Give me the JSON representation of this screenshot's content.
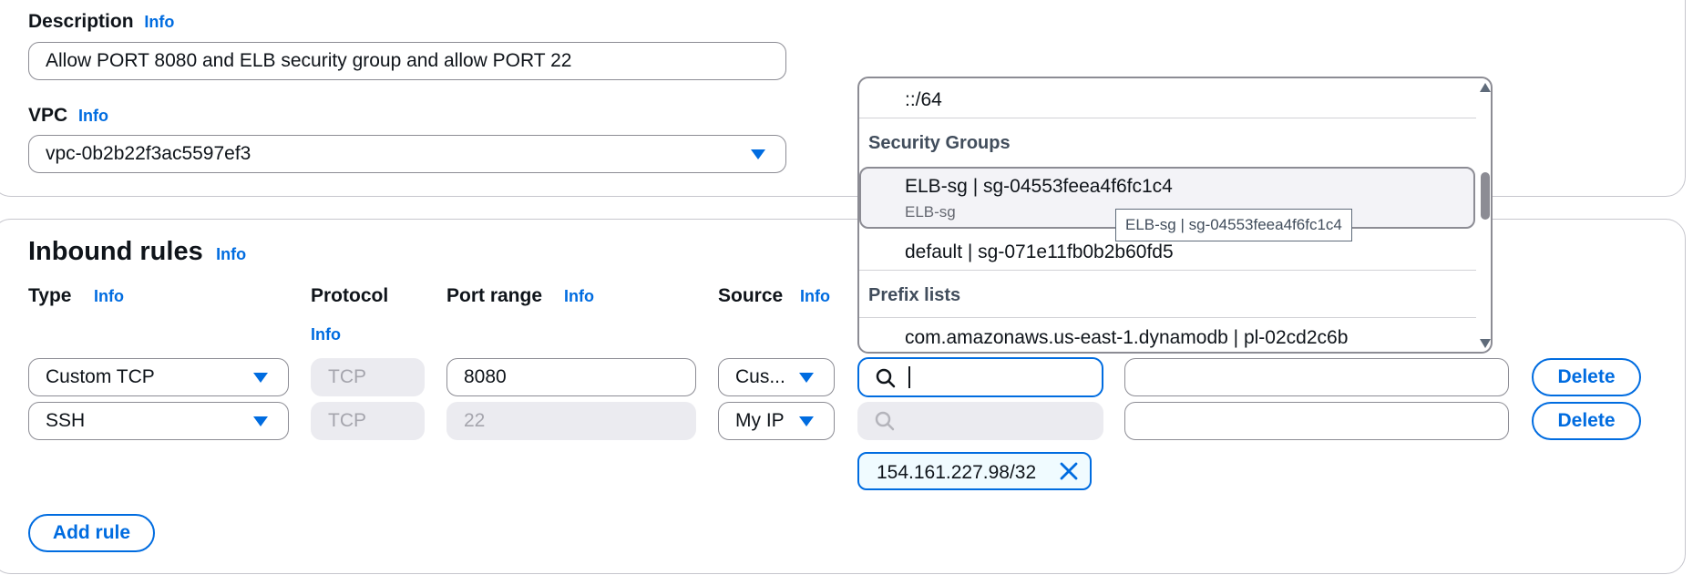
{
  "description": {
    "label": "Description",
    "info": "Info",
    "value": "Allow PORT 8080 and ELB security group and allow PORT 22"
  },
  "vpc": {
    "label": "VPC",
    "info": "Info",
    "value": "vpc-0b2b22f3ac5597ef3"
  },
  "inbound": {
    "title": "Inbound rules",
    "info": "Info",
    "columns": {
      "type": "Type",
      "type_info": "Info",
      "protocol": "Protocol",
      "protocol_info": "Info",
      "port_range": "Port range",
      "port_range_info": "Info",
      "source": "Source",
      "source_info": "Info"
    },
    "rows": [
      {
        "type": "Custom TCP",
        "protocol": "TCP",
        "port": "8080",
        "source": "Cus...",
        "search": "",
        "description": "",
        "delete": "Delete"
      },
      {
        "type": "SSH",
        "protocol": "TCP",
        "port": "22",
        "source": "My IP",
        "search": "",
        "description": "",
        "delete": "Delete",
        "token": "154.161.227.98/32"
      }
    ],
    "add_rule": "Add rule"
  },
  "dropdown": {
    "top_option": "::/64",
    "groups": [
      {
        "header": "Security Groups",
        "options": [
          {
            "label": "ELB-sg | sg-04553feea4f6fc1c4",
            "sub": "ELB-sg",
            "highlighted": true
          },
          {
            "label": "default | sg-071e11fb0b2b60fd5"
          }
        ]
      },
      {
        "header": "Prefix lists",
        "options": [
          {
            "label": "com.amazonaws.us-east-1.dynamodb | pl-02cd2c6b"
          }
        ]
      }
    ],
    "tooltip": "ELB-sg | sg-04553feea4f6fc1c4"
  },
  "colors": {
    "accent": "#006ce0",
    "border": "#8c8c94",
    "disabled_bg": "#ebebf0",
    "text": "#0f141a"
  }
}
